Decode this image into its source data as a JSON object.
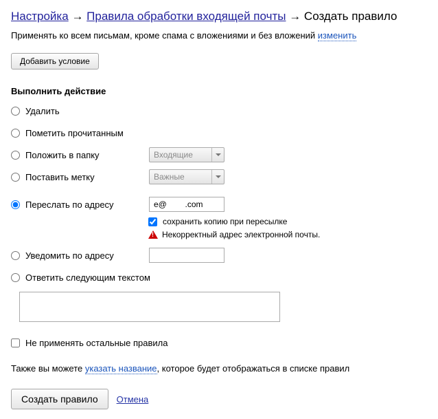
{
  "breadcrumb": {
    "settings": "Настройка",
    "rules": "Правила обработки входящей почты",
    "create": "Создать правило"
  },
  "arrow": "→",
  "apply_text": "Применять ко всем письмам, кроме спама с вложениями и без вложений",
  "change_link": "изменить",
  "add_condition": "Добавить условие",
  "perform_action": "Выполнить действие",
  "actions": {
    "delete": "Удалить",
    "mark_read": "Пометить прочитанным",
    "move_folder": "Положить в папку",
    "set_label": "Поставить метку",
    "forward": "Переслать по адресу",
    "notify": "Уведомить по адресу",
    "reply": "Ответить следующим текстом"
  },
  "selects": {
    "folder": "Входящие",
    "label": "Важные"
  },
  "forward_value": "e@        .com",
  "keep_copy": "сохранить копию при пересылке",
  "error_text": "Некорректный адрес электронной почты.",
  "no_apply": "Не применять остальные правила",
  "name_row": {
    "prefix": "Также вы можете ",
    "link": "указать название",
    "suffix": ", которое будет отображаться в списке правил"
  },
  "footer": {
    "create": "Создать правило",
    "cancel": "Отмена"
  }
}
